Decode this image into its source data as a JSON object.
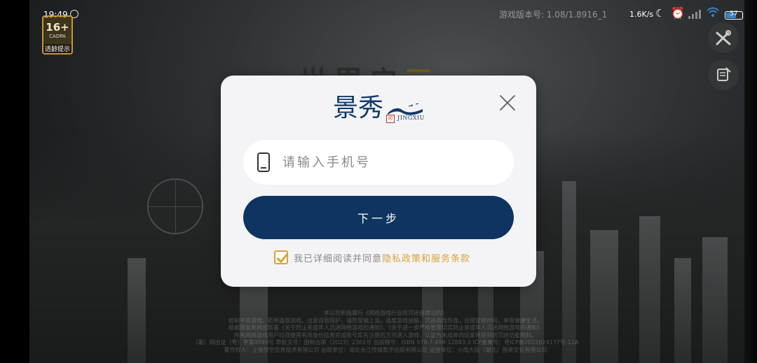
{
  "status_bar": {
    "time": "19:49",
    "speed": "1.6K/s",
    "battery": "57",
    "icons": [
      "notification-icon",
      "moon-icon",
      "alarm-icon",
      "signal-icon",
      "wifi-icon",
      "battery-icon"
    ]
  },
  "background": {
    "version_text": "游戏版本号: 1.08/1.8916_1",
    "game_title_part1": "世界启",
    "game_title_part2": "元",
    "age_badge": {
      "rating": "16+",
      "sub": "CADPA",
      "label": "适龄提示"
    },
    "legal_lines": [
      "本公司积极履行《网络游戏行业防沉迷自律公约》",
      "抵制不良游戏，拒绝盗版游戏。注意自我保护，谨防受骗上当。适度游戏益脑，沉迷游戏伤身。合理安排时间，享受健康生活。",
      "根据国家新闻出版署《关于防止未成年人沉迷网络游戏的通知》、《关于进一步严格管理切实防止未成年人沉迷网络游戏的通知》",
      "所有网络游戏用户均须使用有效身份信息完成账号实名注册后方可进入游戏，认证为未成年的玩家将受到防沉迷功能限制。",
      "（署）网出证（粤）字第0099号 审批文号：国新出审〔2023〕2361号 出版物号：ISBN 978-7-498-12883-3 ICP备案号：粤ICP备2022024177号-12A",
      "著作权人：上海莎空信息技术有限公司 出版单位：湖北长江传媒数字出版有限公司 运营单位：小南大陆（湖北）图果文化有限公司"
    ],
    "side_buttons": [
      "tools-icon",
      "scroll-icon"
    ]
  },
  "dialog": {
    "logo_text": "景秀",
    "logo_sub": "JINGXIU",
    "logo_seal": "印",
    "phone_placeholder": "请输入手机号",
    "phone_value": "",
    "next_label": "下一步",
    "agree_checked": true,
    "agree_text": "我已详细阅读并同意",
    "agree_link": "隐私政策和服务条款"
  },
  "colors": {
    "primary": "#0f3461",
    "accent": "#d9a23a",
    "dialog_bg": "#f4f4f6"
  }
}
